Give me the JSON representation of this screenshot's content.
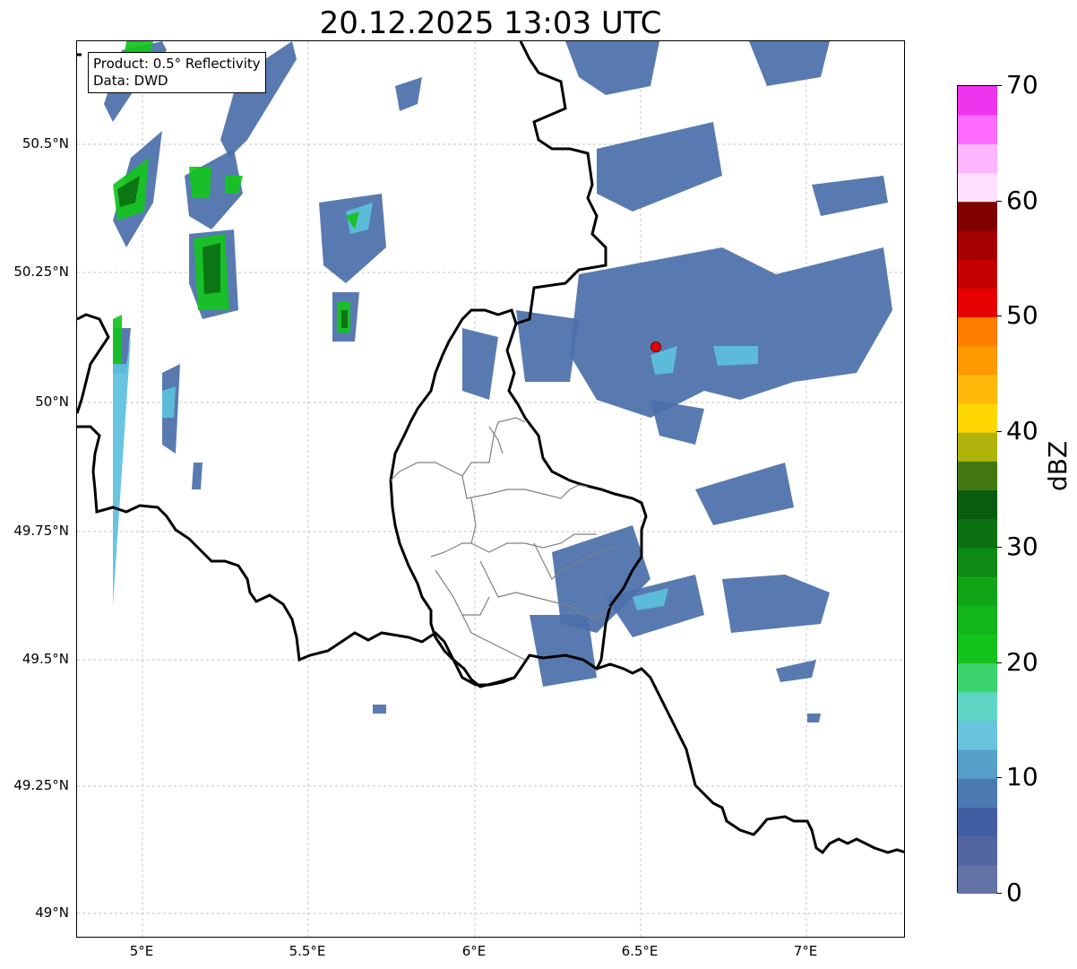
{
  "title": "20.12.2025 13:03 UTC",
  "infobox": {
    "line1": "Product: 0.5° Reflectivity",
    "line2": "Data: DWD"
  },
  "y_ticks": [
    "50.5°N",
    "50.25°N",
    "50°N",
    "49.75°N",
    "49.5°N",
    "49.25°N",
    "49°N"
  ],
  "x_ticks": [
    "5°E",
    "5.5°E",
    "6°E",
    "6.5°E",
    "7°E"
  ],
  "colorbar": {
    "label": "dBZ",
    "ticks": [
      "0",
      "10",
      "20",
      "30",
      "40",
      "50",
      "60",
      "70"
    ],
    "colors": [
      "#6373a6",
      "#5265a0",
      "#435da2",
      "#4b7ab2",
      "#579fc8",
      "#68c3dd",
      "#61d5c4",
      "#3cd46c",
      "#14c41c",
      "#13b61a",
      "#11a417",
      "#0e8a14",
      "#0b7012",
      "#0a5c10",
      "#437811",
      "#afb30a",
      "#ffd700",
      "#ffb80a",
      "#ff9a00",
      "#ff7e00",
      "#e60000",
      "#c40000",
      "#a40000",
      "#800000",
      "#ffe0ff",
      "#ffb5ff",
      "#ff6bff",
      "#ee35ee"
    ]
  },
  "marker": {
    "name": "radar-site",
    "color": "#e60000",
    "lon": 6.55,
    "lat": 50.11
  },
  "map_extent": {
    "lon": [
      4.8,
      7.3
    ],
    "lat": [
      48.95,
      50.7
    ]
  }
}
